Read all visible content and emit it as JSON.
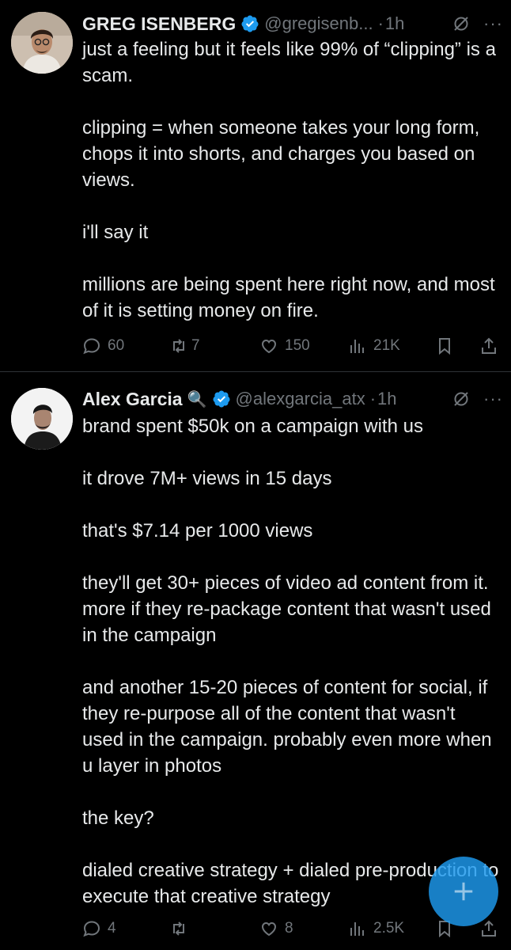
{
  "posts": [
    {
      "author": {
        "name": "GREG ISENBERG",
        "emoji": "",
        "handle": "@gregisenb...",
        "time": "1h"
      },
      "paragraphs": [
        "just a feeling but it feels like 99% of “clipping” is a scam.",
        "clipping = when someone takes your long form, chops it into shorts, and charges you based on views.",
        "i'll say it",
        "millions are being spent here right now, and most of it is setting money on fire."
      ],
      "stats": {
        "replies": "60",
        "reposts": "7",
        "likes": "150",
        "views": "21K"
      }
    },
    {
      "author": {
        "name": "Alex Garcia",
        "emoji": "🔍",
        "handle": "@alexgarcia_atx",
        "time": "1h"
      },
      "paragraphs": [
        "brand spent $50k on a campaign with us",
        "it drove 7M+ views in 15 days",
        "that's $7.14 per 1000 views",
        "they'll get 30+ pieces of video ad content from it. more if they re-package content that wasn't used in the campaign",
        "and another 15-20 pieces of content for social, if they re-purpose all of the content that wasn't used in the campaign. probably even more when u layer in photos",
        "the key?",
        "dialed creative strategy + dialed pre-production to execute that creative strategy"
      ],
      "stats": {
        "replies": "4",
        "reposts": "",
        "likes": "8",
        "views": "2.5K"
      }
    }
  ],
  "icons": {
    "verified": "verified-badge-icon",
    "grok": "grok-icon",
    "more": "more-icon",
    "reply": "reply-icon",
    "repost": "repost-icon",
    "like": "like-icon",
    "views": "views-icon",
    "bookmark": "bookmark-icon",
    "share": "share-icon",
    "compose": "compose-plus-icon"
  },
  "colors": {
    "background": "#000000",
    "text": "#e7e9ea",
    "secondary": "#71767b",
    "accent": "#1d9bf0",
    "divider": "#2f3336"
  }
}
